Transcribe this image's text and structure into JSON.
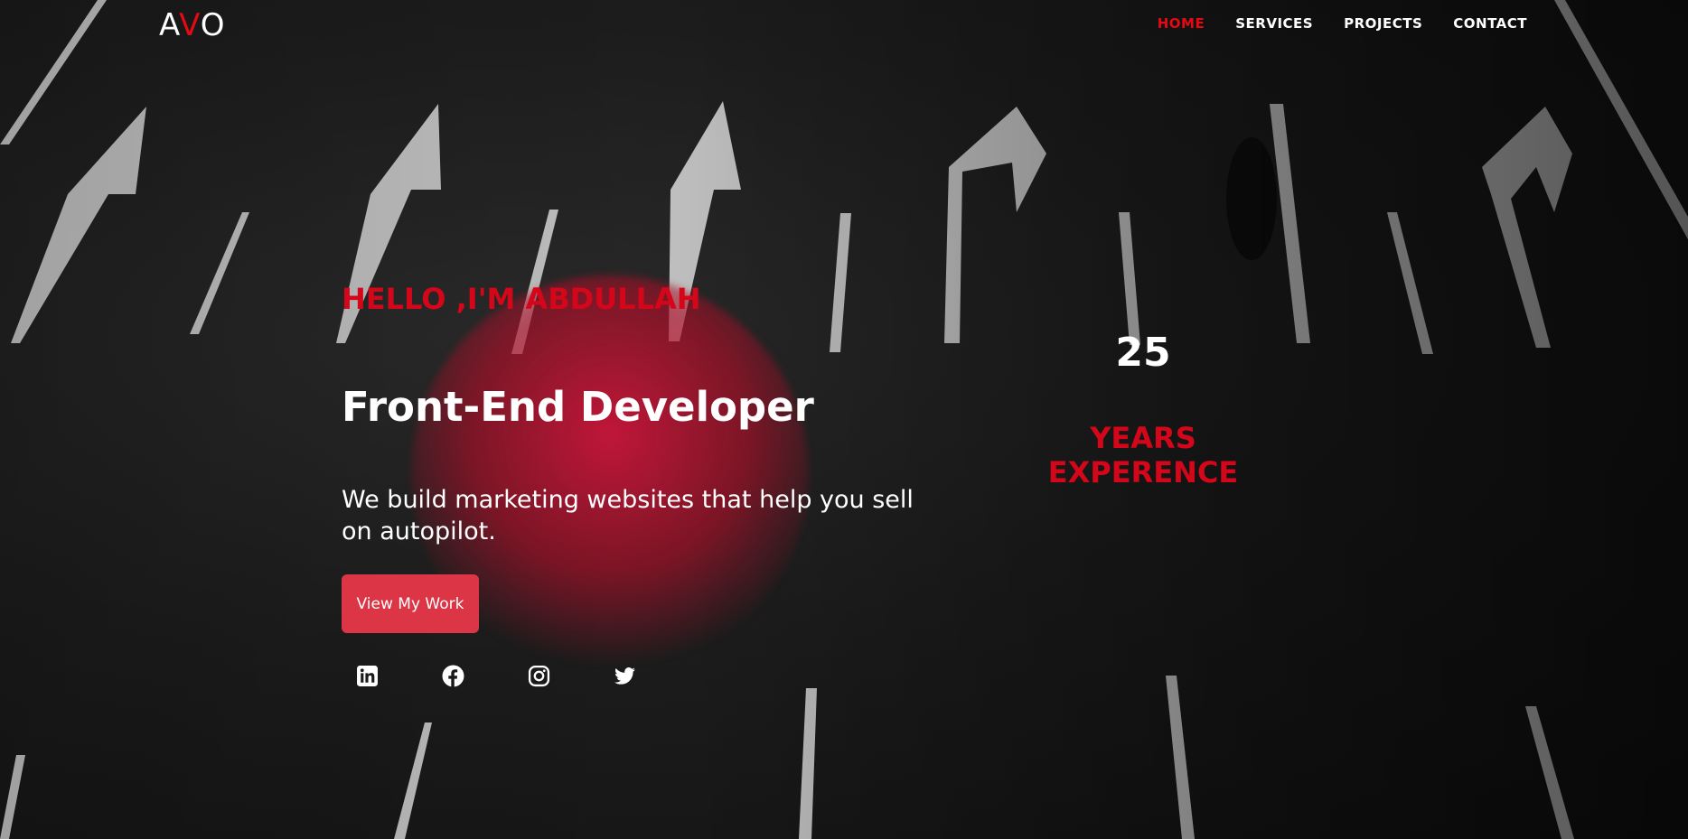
{
  "brand": {
    "prefix": "A",
    "highlight": "V",
    "suffix": "O"
  },
  "nav": {
    "items": [
      {
        "label": "HOME",
        "active": true
      },
      {
        "label": "SERVICES",
        "active": false
      },
      {
        "label": "PROJECTS",
        "active": false
      },
      {
        "label": "CONTACT",
        "active": false
      }
    ]
  },
  "hero": {
    "greeting": "HELLO ,I'M ABDULLAH",
    "role": "Front-End Developer",
    "description": "We build marketing websites that help you sell on autopilot.",
    "cta_label": "View My Work"
  },
  "socials": [
    {
      "icon": "linkedin-icon"
    },
    {
      "icon": "facebook-icon"
    },
    {
      "icon": "instagram-icon"
    },
    {
      "icon": "twitter-icon"
    }
  ],
  "stats": {
    "number": "25",
    "label": "YEARS EXPERENCE"
  },
  "colors": {
    "accent": "#e50914",
    "button": "#dc3545",
    "background": "#1a1a1a"
  }
}
